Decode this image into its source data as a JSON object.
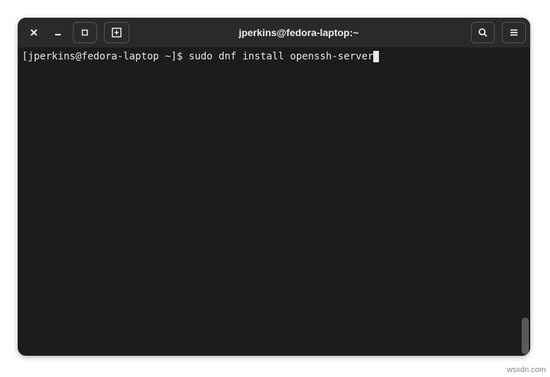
{
  "window": {
    "title": "jperkins@fedora-laptop:~"
  },
  "terminal": {
    "prompt": "[jperkins@fedora-laptop ~]$ ",
    "command": "sudo dnf install openssh-server"
  },
  "watermark": "wsxdn.com"
}
